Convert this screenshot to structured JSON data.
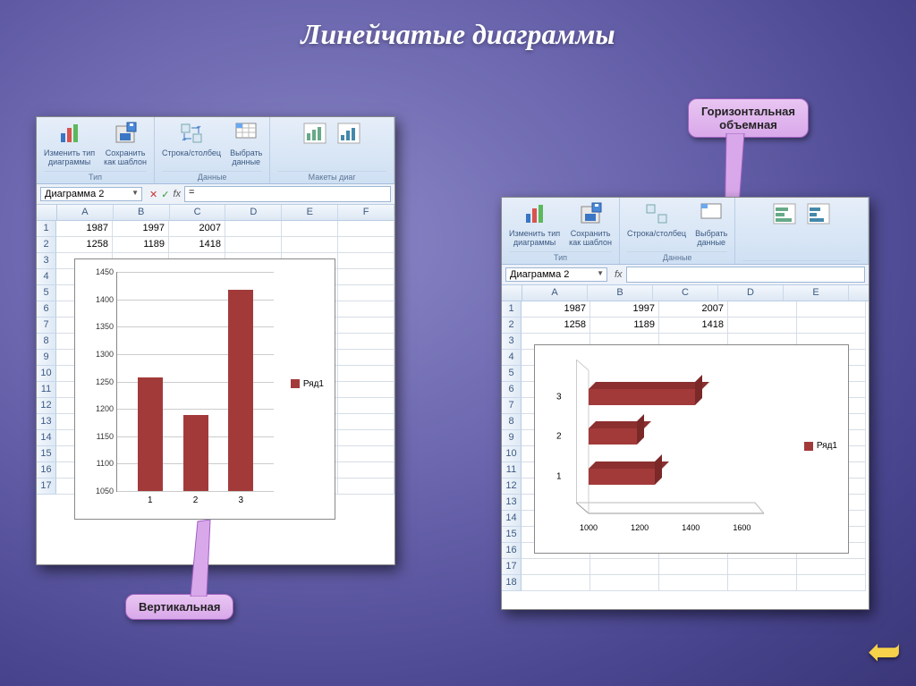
{
  "title": "Линейчатые  диаграммы",
  "callouts": {
    "top": {
      "line1": "Горизонтальная",
      "line2": "объемная"
    },
    "bottom": "Вертикальная"
  },
  "ribbon": {
    "btn_change_type": "Изменить тип\nдиаграммы",
    "btn_save_template": "Сохранить\nкак шаблон",
    "btn_row_col": "Строка/столбец",
    "btn_select_data": "Выбрать\nданные",
    "group_type": "Тип",
    "group_data": "Данные",
    "group_layouts": "Макеты диаг"
  },
  "namebox": "Диаграмма 2",
  "formula": "=",
  "columns": [
    "A",
    "B",
    "C",
    "D",
    "E",
    "F"
  ],
  "columns_right": [
    "A",
    "B",
    "C",
    "D",
    "E"
  ],
  "data_rows": [
    [
      1987,
      1997,
      2007
    ],
    [
      1258,
      1189,
      1418
    ]
  ],
  "legend": "Ряд1",
  "chart_data": [
    {
      "type": "bar",
      "orientation": "vertical",
      "categories": [
        "1",
        "2",
        "3"
      ],
      "values": [
        1258,
        1189,
        1418
      ],
      "series_name": "Ряд1",
      "ylim": [
        1050,
        1450
      ],
      "yticks": [
        1050,
        1100,
        1150,
        1200,
        1250,
        1300,
        1350,
        1400,
        1450
      ]
    },
    {
      "type": "bar",
      "orientation": "horizontal-3d",
      "categories": [
        "1",
        "2",
        "3"
      ],
      "values": [
        1258,
        1189,
        1418
      ],
      "series_name": "Ряд1",
      "xlim": [
        1000,
        1700
      ],
      "xticks": [
        1000,
        1200,
        1400,
        1600
      ]
    }
  ]
}
